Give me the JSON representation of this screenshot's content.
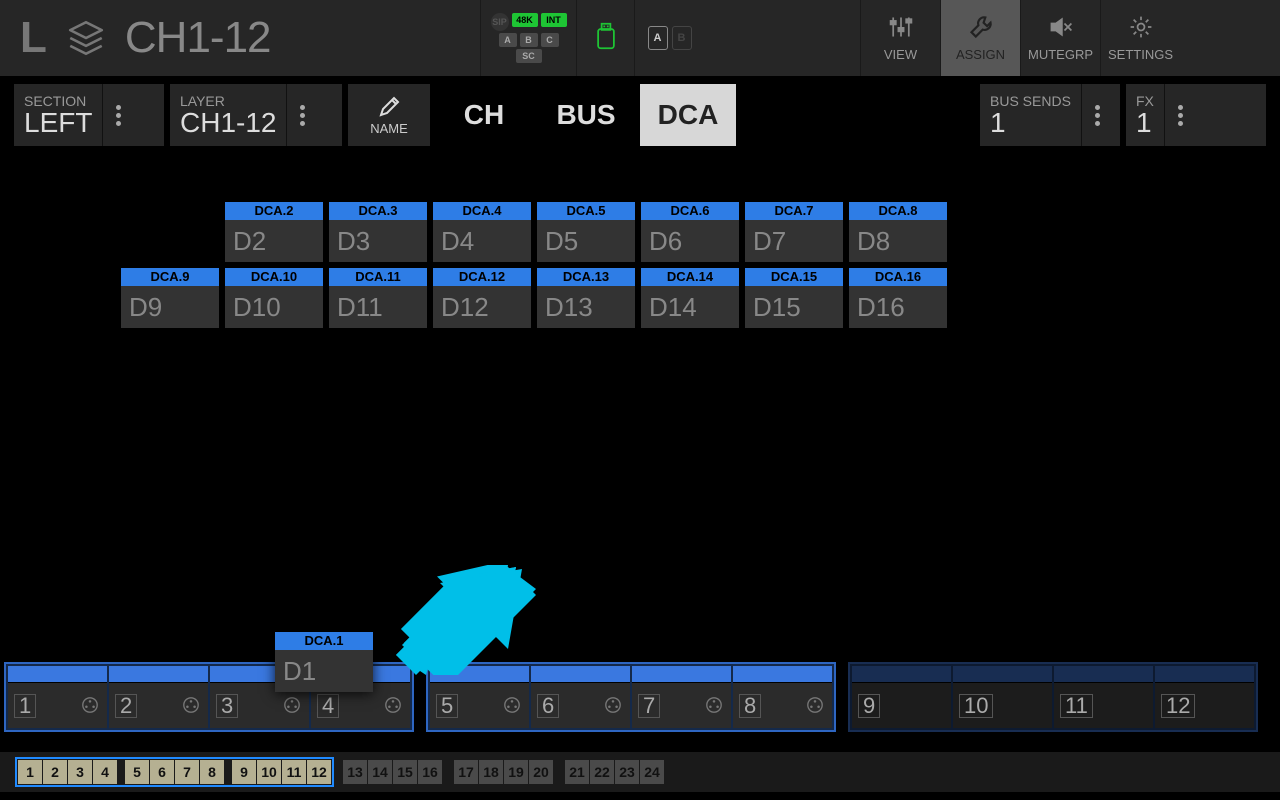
{
  "header": {
    "side": "L",
    "title": "CH1-12",
    "badges": {
      "sip": "SIP",
      "rate": "48K",
      "int": "INT",
      "a": "A",
      "b": "B",
      "c": "C",
      "sc": "SC"
    },
    "card_a": "A",
    "card_b": "B",
    "tools": {
      "view": "VIEW",
      "assign": "ASSIGN",
      "mutegrp": "MUTEGRP",
      "settings": "SETTINGS"
    }
  },
  "config": {
    "section": {
      "label": "SECTION",
      "value": "LEFT"
    },
    "layer": {
      "label": "LAYER",
      "value": "CH1-12"
    },
    "name_label": "NAME",
    "tabs": {
      "ch": "CH",
      "bus": "BUS",
      "dca": "DCA"
    },
    "bussends": {
      "label": "BUS SENDS",
      "value": "1"
    },
    "fx": {
      "label": "FX",
      "value": "1"
    }
  },
  "dca": {
    "row1": [
      {
        "head": "DCA.2",
        "body": "D2"
      },
      {
        "head": "DCA.3",
        "body": "D3"
      },
      {
        "head": "DCA.4",
        "body": "D4"
      },
      {
        "head": "DCA.5",
        "body": "D5"
      },
      {
        "head": "DCA.6",
        "body": "D6"
      },
      {
        "head": "DCA.7",
        "body": "D7"
      },
      {
        "head": "DCA.8",
        "body": "D8"
      }
    ],
    "row2": [
      {
        "head": "DCA.9",
        "body": "D9"
      },
      {
        "head": "DCA.10",
        "body": "D10"
      },
      {
        "head": "DCA.11",
        "body": "D11"
      },
      {
        "head": "DCA.12",
        "body": "D12"
      },
      {
        "head": "DCA.13",
        "body": "D13"
      },
      {
        "head": "DCA.14",
        "body": "D14"
      },
      {
        "head": "DCA.15",
        "body": "D15"
      },
      {
        "head": "DCA.16",
        "body": "D16"
      }
    ],
    "drag": {
      "head": "DCA.1",
      "body": "D1"
    }
  },
  "slots": {
    "groupA": [
      "1",
      "2",
      "3",
      "4"
    ],
    "groupB": [
      "5",
      "6",
      "7",
      "8"
    ],
    "groupC": [
      "9",
      "10",
      "11",
      "12"
    ]
  },
  "pager": {
    "g1": [
      "1",
      "2",
      "3",
      "4"
    ],
    "g2": [
      "5",
      "6",
      "7",
      "8"
    ],
    "g3": [
      "9",
      "10",
      "11",
      "12"
    ],
    "g4": [
      "13",
      "14",
      "15",
      "16"
    ],
    "g5": [
      "17",
      "18",
      "19",
      "20"
    ],
    "g6": [
      "21",
      "22",
      "23",
      "24"
    ]
  }
}
